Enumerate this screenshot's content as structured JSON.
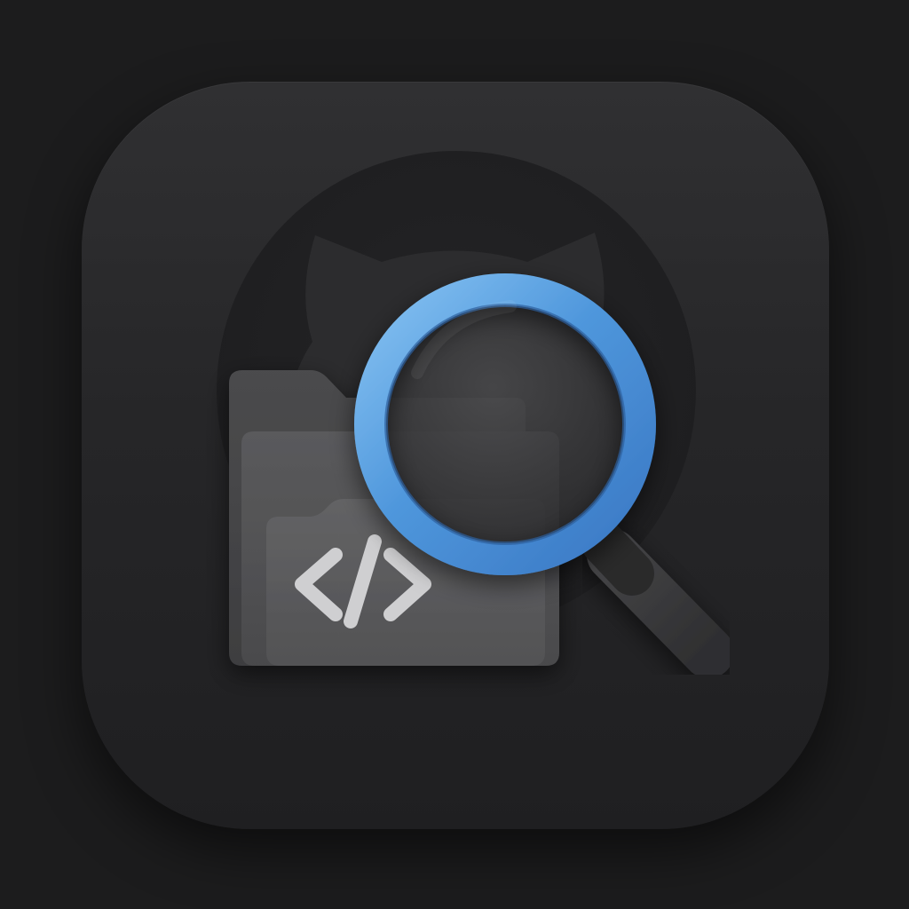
{
  "icon": {
    "name": "repository-search-app-icon",
    "symbols": [
      "octocat-silhouette-icon",
      "folder-icon",
      "code-brackets-icon",
      "magnifying-glass-icon"
    ],
    "colors": {
      "background": "#1c1c1d",
      "tile_top": "#303032",
      "tile_bottom": "#1f1f21",
      "folder": "#505052",
      "folder_front": "#606062",
      "lens_ring": "#4a90d9",
      "lens_ring_light": "#7fbdf0",
      "handle": "#3a3a3c",
      "code_glyph": "#cfcfd1"
    }
  }
}
